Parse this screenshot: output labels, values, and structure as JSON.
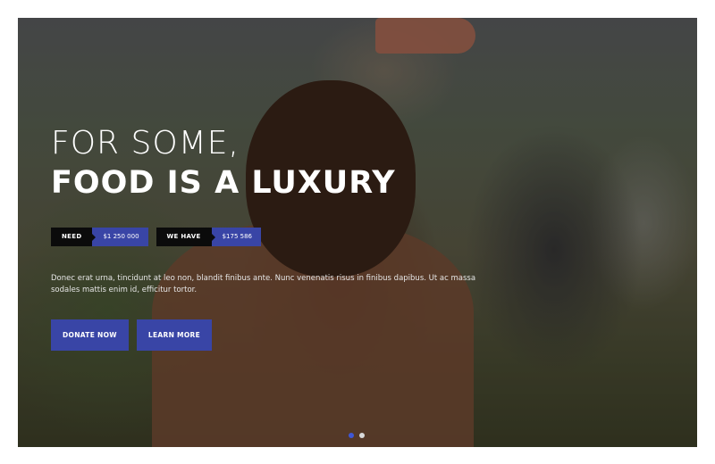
{
  "hero": {
    "title_line1": "FOR SOME,",
    "title_line2": "FOOD IS A LUXURY",
    "stats": [
      {
        "label": "NEED",
        "value": "$1 250 000"
      },
      {
        "label": "WE HAVE",
        "value": "$175 586"
      }
    ],
    "description": "Donec erat urna, tincidunt at leo non, blandit finibus ante. Nunc venenatis risus in finibus dapibus. Ut ac massa sodales mattis enim id, efficitur tortor.",
    "buttons": {
      "donate_label": "DONATE NOW",
      "learn_label": "LEARN MORE"
    },
    "slider": {
      "slide_count": 2,
      "active_slide": 1
    }
  },
  "colors": {
    "accent": "#3945a6",
    "label_bg": "#0b0b0b",
    "active_dot": "#3f57d6",
    "inactive_dot": "#d9d9d9"
  }
}
